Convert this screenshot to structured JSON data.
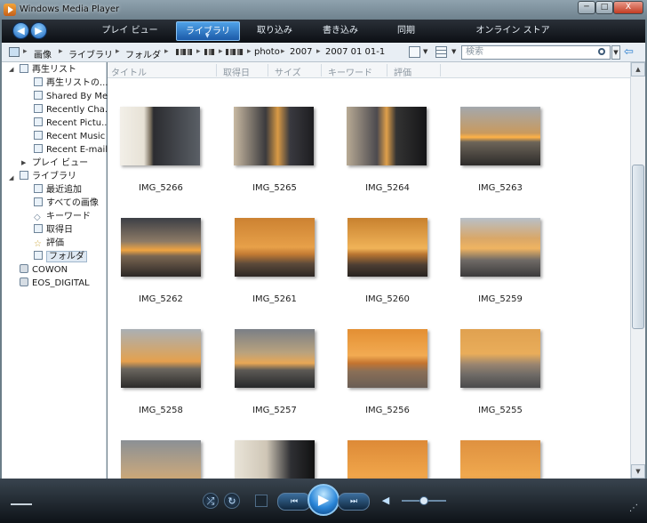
{
  "window": {
    "title": "Windows Media Player",
    "buttons": {
      "minimize": "─",
      "maximize": "□",
      "close": "X"
    }
  },
  "nav": {
    "back_icon": "◀",
    "forward_icon": "▶",
    "tabs": [
      {
        "label": "プレイ ビュー",
        "active": false
      },
      {
        "label": "ライブラリ",
        "active": true
      },
      {
        "label": "取り込み",
        "active": false
      },
      {
        "label": "書き込み",
        "active": false
      },
      {
        "label": "同期",
        "active": false
      },
      {
        "label": "オンライン ストア",
        "active": false
      }
    ]
  },
  "address": {
    "crumbs": [
      "画像",
      "ライブラリ",
      "フォルダ",
      "photo",
      "2007",
      "2007 01 01-1"
    ],
    "separator": "▸",
    "search_placeholder": "検索"
  },
  "sidebar": {
    "playlists_header": "再生リスト",
    "playlists": [
      "再生リストの...",
      "Shared By Me",
      "Recently Cha...",
      "Recent Pictu...",
      "Recent Music",
      "Recent E-mail"
    ],
    "play_view": "プレイ ビュー",
    "library_header": "ライブラリ",
    "library_items": [
      "最近追加",
      "すべての画像",
      "キーワード",
      "取得日",
      "評価",
      "フォルダ"
    ],
    "devices": [
      "COWON",
      "EOS_DIGITAL"
    ]
  },
  "columns": [
    "タイトル",
    "取得日",
    "サイズ",
    "キーワード",
    "評価"
  ],
  "tiles": [
    {
      "name": "IMG_5266"
    },
    {
      "name": "IMG_5265"
    },
    {
      "name": "IMG_5264"
    },
    {
      "name": "IMG_5263"
    },
    {
      "name": "IMG_5262"
    },
    {
      "name": "IMG_5261"
    },
    {
      "name": "IMG_5260"
    },
    {
      "name": "IMG_5259"
    },
    {
      "name": "IMG_5258"
    },
    {
      "name": "IMG_5257"
    },
    {
      "name": "IMG_5256"
    },
    {
      "name": "IMG_5255"
    },
    {
      "name": ""
    },
    {
      "name": ""
    },
    {
      "name": ""
    },
    {
      "name": ""
    }
  ],
  "player": {
    "play_icon": "▶",
    "prev_icon": "⏮",
    "next_icon": "⏭",
    "volume": 0.5
  },
  "colors": {
    "accent": "#1b5aa8",
    "selection": "#dfe9f3"
  }
}
